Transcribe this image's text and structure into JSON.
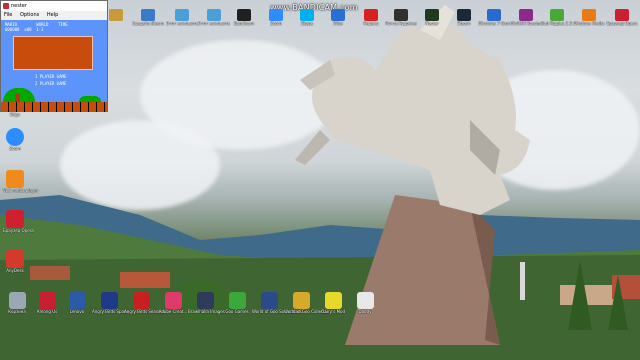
{
  "watermark": "www.BANDICAM.com",
  "window": {
    "title": "nester",
    "menu": [
      "File",
      "Options",
      "Help"
    ],
    "game": {
      "hud": "MARIO        WORLD    TIME\n000000  x00  1-1",
      "menu_1": "1 PLAYER GAME",
      "menu_2": "2 PLAYER GAME"
    }
  },
  "top_icons": [
    {
      "label": "",
      "color": "#c89a3a",
      "icon": "folder-icon"
    },
    {
      "label": "Свадьба (Бесплат)",
      "color": "#3a7ac8",
      "icon": "app-icon"
    },
    {
      "label": "Этот компьютер",
      "color": "#4aa0d8",
      "icon": "computer-icon"
    },
    {
      "label": "Этот компьютер",
      "color": "#4aa0d8",
      "icon": "computer-icon"
    },
    {
      "label": "Bandicam",
      "color": "#202020",
      "icon": "bandicam-icon"
    },
    {
      "label": "Zoom",
      "color": "#2d8cff",
      "icon": "zoom-icon"
    },
    {
      "label": "Skype",
      "color": "#00aff0",
      "icon": "skype-icon"
    },
    {
      "label": "Wise",
      "color": "#2a6fd6",
      "icon": "wise-icon"
    },
    {
      "label": "Яндекс",
      "color": "#d82020",
      "icon": "yandex-icon"
    },
    {
      "label": "Почта Рудоменка",
      "color": "#303030",
      "icon": "mail-icon"
    },
    {
      "label": "Nester",
      "color": "#203a20",
      "icon": "nester-icon"
    },
    {
      "label": "Steam",
      "color": "#1b2838",
      "icon": "steam-icon"
    },
    {
      "label": "Windows 7 Games for Win 10",
      "color": "#2a6ad0",
      "icon": "games-icon"
    },
    {
      "label": "WinRAR Russian Version",
      "color": "#8a2a8a",
      "icon": "winrar-icon"
    },
    {
      "label": "Bad Piggies 2.3.6 Windows",
      "color": "#4aa838",
      "icon": "badpiggies-icon"
    },
    {
      "label": "Windows Media Player",
      "color": "#e87a1a",
      "icon": "media-player-icon"
    },
    {
      "label": "Браузер Opera",
      "color": "#cc1f2f",
      "icon": "opera-icon"
    }
  ],
  "left_icons": [
    {
      "label": "Edge",
      "color": "#1f8ad0",
      "icon": "edge-icon"
    },
    {
      "label": "Zoom",
      "color": "#2d8cff",
      "icon": "zoom-icon"
    },
    {
      "label": "VLC media player",
      "color": "#f08a1a",
      "icon": "vlc-icon"
    },
    {
      "label": "Браузер Opera",
      "color": "#d02030",
      "icon": "opera-icon"
    },
    {
      "label": "AnyDesk",
      "color": "#d43a2a",
      "icon": "anydesk-icon"
    }
  ],
  "bottom_icons": [
    {
      "label": "Корзина",
      "color": "#9aa8b4",
      "icon": "recycle-bin-icon"
    },
    {
      "label": "Among Us",
      "color": "#c82030",
      "icon": "amongus-icon"
    },
    {
      "label": "Lenovo",
      "color": "#2a5aa8",
      "icon": "app-icon"
    },
    {
      "label": "Angry Birds Space",
      "color": "#203a8a",
      "icon": "angrybirds-space-icon"
    },
    {
      "label": "Angry Birds Seasons",
      "color": "#c82020",
      "icon": "angrybirds-seasons-icon"
    },
    {
      "label": "Adobe Creat...",
      "color": "#e03a6a",
      "icon": "adobe-icon"
    },
    {
      "label": "Brawlhalla Images",
      "color": "#303a5a",
      "icon": "brawlhalla-icon"
    },
    {
      "label": "Goo Games",
      "color": "#3aa83a",
      "icon": "goo-icon"
    },
    {
      "label": "World of Goo Soundtrack",
      "color": "#2a4a8a",
      "icon": "music-icon"
    },
    {
      "label": "World of Goo Collection",
      "color": "#d8a82a",
      "icon": "goo-collection-icon"
    },
    {
      "label": "Garry's Mod",
      "color": "#e8d82a",
      "icon": "garrysmod-icon"
    },
    {
      "label": "Daddy",
      "color": "#e8e8e8",
      "icon": "document-icon"
    }
  ]
}
